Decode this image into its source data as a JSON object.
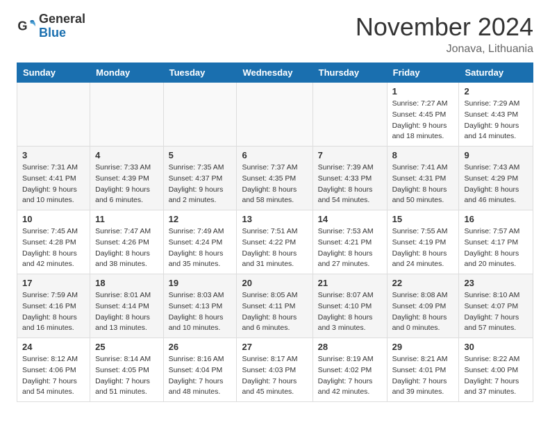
{
  "header": {
    "logo_general": "General",
    "logo_blue": "Blue",
    "month_title": "November 2024",
    "location": "Jonava, Lithuania"
  },
  "weekdays": [
    "Sunday",
    "Monday",
    "Tuesday",
    "Wednesday",
    "Thursday",
    "Friday",
    "Saturday"
  ],
  "weeks": [
    [
      {
        "day": "",
        "info": ""
      },
      {
        "day": "",
        "info": ""
      },
      {
        "day": "",
        "info": ""
      },
      {
        "day": "",
        "info": ""
      },
      {
        "day": "",
        "info": ""
      },
      {
        "day": "1",
        "info": "Sunrise: 7:27 AM\nSunset: 4:45 PM\nDaylight: 9 hours and 18 minutes."
      },
      {
        "day": "2",
        "info": "Sunrise: 7:29 AM\nSunset: 4:43 PM\nDaylight: 9 hours and 14 minutes."
      }
    ],
    [
      {
        "day": "3",
        "info": "Sunrise: 7:31 AM\nSunset: 4:41 PM\nDaylight: 9 hours and 10 minutes."
      },
      {
        "day": "4",
        "info": "Sunrise: 7:33 AM\nSunset: 4:39 PM\nDaylight: 9 hours and 6 minutes."
      },
      {
        "day": "5",
        "info": "Sunrise: 7:35 AM\nSunset: 4:37 PM\nDaylight: 9 hours and 2 minutes."
      },
      {
        "day": "6",
        "info": "Sunrise: 7:37 AM\nSunset: 4:35 PM\nDaylight: 8 hours and 58 minutes."
      },
      {
        "day": "7",
        "info": "Sunrise: 7:39 AM\nSunset: 4:33 PM\nDaylight: 8 hours and 54 minutes."
      },
      {
        "day": "8",
        "info": "Sunrise: 7:41 AM\nSunset: 4:31 PM\nDaylight: 8 hours and 50 minutes."
      },
      {
        "day": "9",
        "info": "Sunrise: 7:43 AM\nSunset: 4:29 PM\nDaylight: 8 hours and 46 minutes."
      }
    ],
    [
      {
        "day": "10",
        "info": "Sunrise: 7:45 AM\nSunset: 4:28 PM\nDaylight: 8 hours and 42 minutes."
      },
      {
        "day": "11",
        "info": "Sunrise: 7:47 AM\nSunset: 4:26 PM\nDaylight: 8 hours and 38 minutes."
      },
      {
        "day": "12",
        "info": "Sunrise: 7:49 AM\nSunset: 4:24 PM\nDaylight: 8 hours and 35 minutes."
      },
      {
        "day": "13",
        "info": "Sunrise: 7:51 AM\nSunset: 4:22 PM\nDaylight: 8 hours and 31 minutes."
      },
      {
        "day": "14",
        "info": "Sunrise: 7:53 AM\nSunset: 4:21 PM\nDaylight: 8 hours and 27 minutes."
      },
      {
        "day": "15",
        "info": "Sunrise: 7:55 AM\nSunset: 4:19 PM\nDaylight: 8 hours and 24 minutes."
      },
      {
        "day": "16",
        "info": "Sunrise: 7:57 AM\nSunset: 4:17 PM\nDaylight: 8 hours and 20 minutes."
      }
    ],
    [
      {
        "day": "17",
        "info": "Sunrise: 7:59 AM\nSunset: 4:16 PM\nDaylight: 8 hours and 16 minutes."
      },
      {
        "day": "18",
        "info": "Sunrise: 8:01 AM\nSunset: 4:14 PM\nDaylight: 8 hours and 13 minutes."
      },
      {
        "day": "19",
        "info": "Sunrise: 8:03 AM\nSunset: 4:13 PM\nDaylight: 8 hours and 10 minutes."
      },
      {
        "day": "20",
        "info": "Sunrise: 8:05 AM\nSunset: 4:11 PM\nDaylight: 8 hours and 6 minutes."
      },
      {
        "day": "21",
        "info": "Sunrise: 8:07 AM\nSunset: 4:10 PM\nDaylight: 8 hours and 3 minutes."
      },
      {
        "day": "22",
        "info": "Sunrise: 8:08 AM\nSunset: 4:09 PM\nDaylight: 8 hours and 0 minutes."
      },
      {
        "day": "23",
        "info": "Sunrise: 8:10 AM\nSunset: 4:07 PM\nDaylight: 7 hours and 57 minutes."
      }
    ],
    [
      {
        "day": "24",
        "info": "Sunrise: 8:12 AM\nSunset: 4:06 PM\nDaylight: 7 hours and 54 minutes."
      },
      {
        "day": "25",
        "info": "Sunrise: 8:14 AM\nSunset: 4:05 PM\nDaylight: 7 hours and 51 minutes."
      },
      {
        "day": "26",
        "info": "Sunrise: 8:16 AM\nSunset: 4:04 PM\nDaylight: 7 hours and 48 minutes."
      },
      {
        "day": "27",
        "info": "Sunrise: 8:17 AM\nSunset: 4:03 PM\nDaylight: 7 hours and 45 minutes."
      },
      {
        "day": "28",
        "info": "Sunrise: 8:19 AM\nSunset: 4:02 PM\nDaylight: 7 hours and 42 minutes."
      },
      {
        "day": "29",
        "info": "Sunrise: 8:21 AM\nSunset: 4:01 PM\nDaylight: 7 hours and 39 minutes."
      },
      {
        "day": "30",
        "info": "Sunrise: 8:22 AM\nSunset: 4:00 PM\nDaylight: 7 hours and 37 minutes."
      }
    ]
  ]
}
